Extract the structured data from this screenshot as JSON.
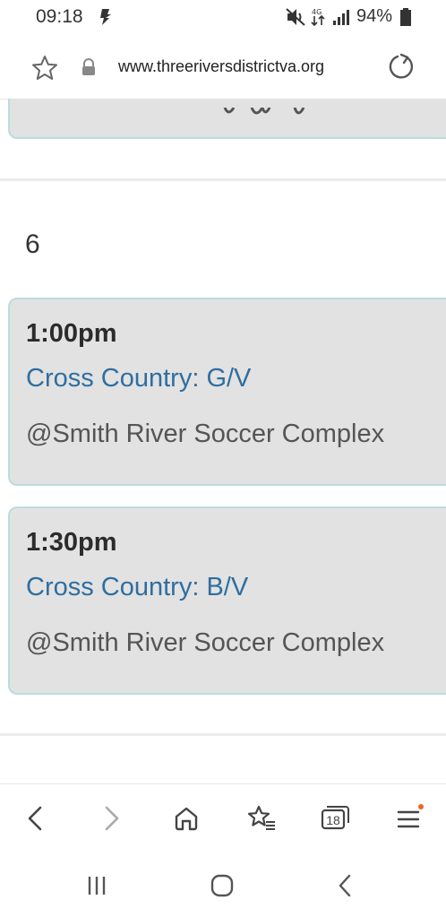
{
  "status_bar": {
    "time": "09:18",
    "battery": "94%",
    "icons": [
      "notification-icon",
      "mute-icon",
      "data-arrows-icon",
      "signal-icon",
      "battery-icon"
    ]
  },
  "browser": {
    "url": "www.threeriversdistrictva.org",
    "icons": [
      "bookmark-star-icon",
      "lock-icon",
      "reload-icon"
    ]
  },
  "day": {
    "number": "6"
  },
  "events": [
    {
      "time": "1:00pm",
      "title": "Cross Country: G/V",
      "location": "@Smith River Soccer Complex"
    },
    {
      "time": "1:30pm",
      "title": "Cross Country: B/V",
      "location": "@Smith River Soccer Complex"
    }
  ],
  "bottom_nav": {
    "tabs_count": "18",
    "icons": [
      "back-icon",
      "forward-icon",
      "home-icon",
      "bookmarks-icon",
      "tabs-icon",
      "menu-icon"
    ],
    "menu_badge_color": "#f06423"
  },
  "system_nav": {
    "icons": [
      "recents-icon",
      "home-circle-icon",
      "system-back-icon"
    ]
  },
  "colors": {
    "card_bg": "#e2e2e2",
    "card_border": "#bcdcdc",
    "link": "#2f6ea0"
  }
}
